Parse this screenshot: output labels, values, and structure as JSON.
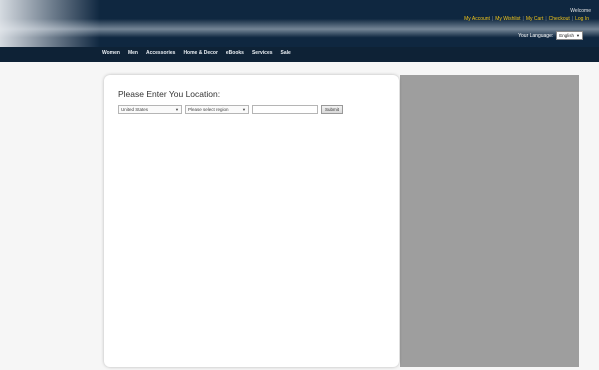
{
  "header": {
    "welcome_text": "Welcome",
    "account_links": [
      {
        "label": "My Account"
      },
      {
        "label": "My Wishlist"
      },
      {
        "label": "My Cart"
      },
      {
        "label": "Checkout"
      },
      {
        "label": "Log In"
      }
    ],
    "language_label": "Your Language:",
    "language_value": "English"
  },
  "nav": {
    "items": [
      "Women",
      "Men",
      "Accessories",
      "Home & Decor",
      "eBooks",
      "Services",
      "Sale"
    ]
  },
  "location_modal": {
    "title": "Please Enter You Location:",
    "country_value": "United States",
    "region_value": "Please select region",
    "postcode_value": "",
    "submit_label": "Submit"
  },
  "colors": {
    "header_bg": "#0f2740",
    "nav_bg": "#0e2236",
    "account_link": "#f0c419",
    "overlay_gray": "#9e9e9e"
  }
}
